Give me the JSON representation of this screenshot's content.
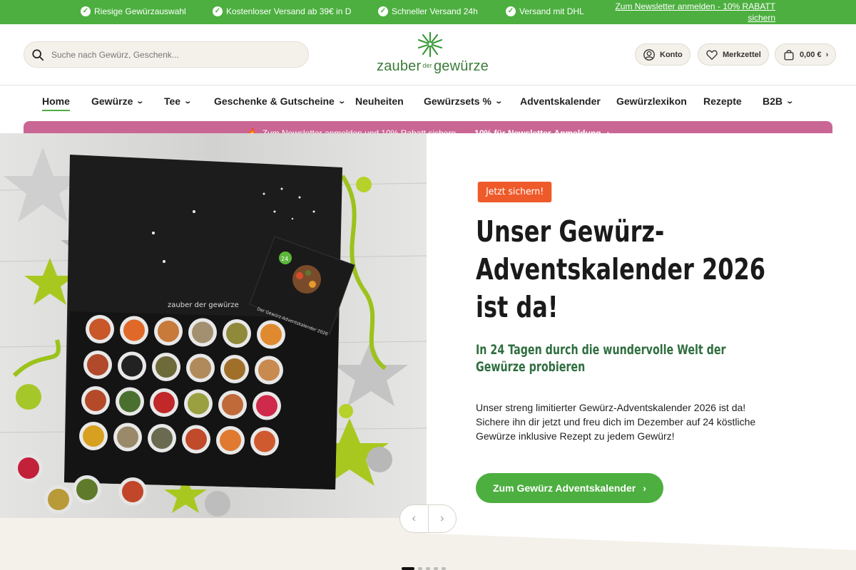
{
  "topbar": {
    "usps": [
      "Riesige Gewürzauswahl",
      "Kostenloser Versand ab 39€ in D",
      "Schneller Versand 24h",
      "Versand mit DHL"
    ],
    "newsletter_link": "Zum Newsletter anmelden - 10% RABATT sichern"
  },
  "header": {
    "search_placeholder": "Suche nach Gewürz, Geschenk...",
    "logo": {
      "word1": "zauber",
      "word2": "der",
      "word3": "gewürze"
    },
    "account_label": "Konto",
    "wishlist_label": "Merkzettel",
    "cart_label": "0,00 €"
  },
  "nav": {
    "items": [
      {
        "label": "Home",
        "dropdown": false
      },
      {
        "label": "Gewürze",
        "dropdown": true
      },
      {
        "label": "Tee",
        "dropdown": true
      },
      {
        "label": "Geschenke & Gutscheine",
        "dropdown": true
      },
      {
        "label": "Neuheiten",
        "dropdown": false
      },
      {
        "label": "Gewürzsets %",
        "dropdown": true
      },
      {
        "label": "Adventskalender",
        "dropdown": false
      },
      {
        "label": "Gewürzlexikon",
        "dropdown": false
      },
      {
        "label": "Rezepte",
        "dropdown": false
      },
      {
        "label": "B2B",
        "dropdown": true
      }
    ]
  },
  "promo": {
    "text": "Zum Newsletter anmelden und 10% Rabatt sichern",
    "cta": "10% für Newsletter-Anmeldung"
  },
  "hero": {
    "badge": "Jetzt sichern!",
    "headline": "Unser Gewürz-Adventskalender 2026 ist da!",
    "subline": "In 24 Tagen durch die wundervolle Welt der Gewürze probieren",
    "body": "Unser streng limitierter Gewürz-Adventskalender 2026 ist da! Sichere ihn dir jetzt und freu dich im Dezember auf 24 köstliche Gewürze inklusive Rezept zu jedem Gewürz!",
    "cta": "Zum Gewürz Adventskalender",
    "image": {
      "box_brand": "zauber der gewürze",
      "card_title": "Der Gewürz-Adventskalender 2026",
      "card_number": "24"
    }
  },
  "slider": {
    "slide_count": 5,
    "active_index": 0
  },
  "colors": {
    "brand_green": "#4caf3f",
    "promo_pink": "#c96694",
    "badge_orange": "#ef5a2a",
    "subline_green": "#2f6e3f",
    "cream": "#f4f1ea"
  }
}
